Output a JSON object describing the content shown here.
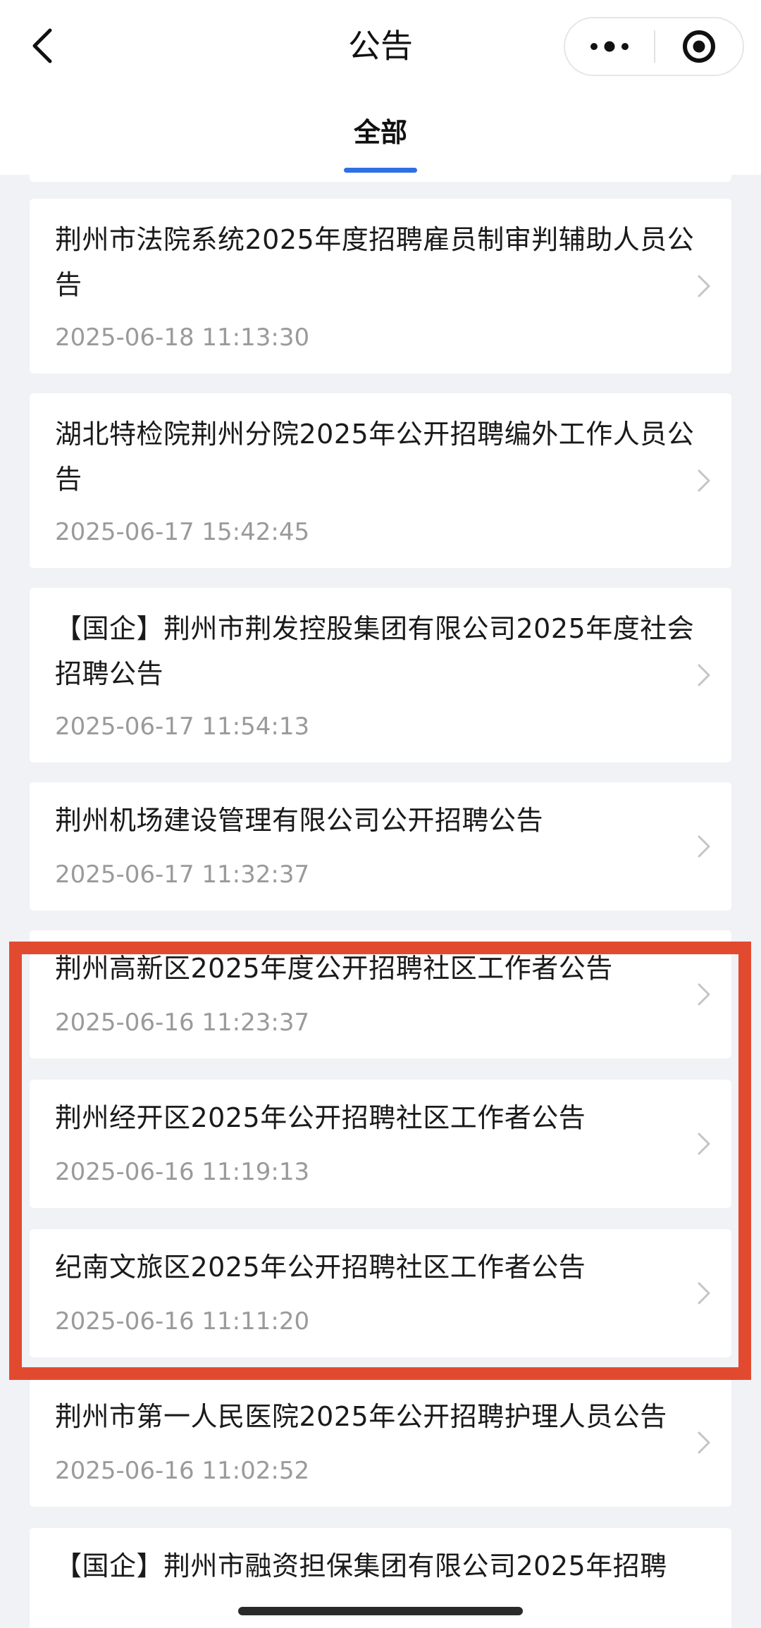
{
  "header": {
    "title": "公告",
    "tab_label": "全部",
    "accent_color": "#2f6fe4",
    "back_icon": "chevron-left-icon",
    "more_icon": "more-dots-icon",
    "close_icon": "target-circle-icon"
  },
  "announcements": [
    {
      "title": "荆州市法院系统2025年度招聘雇员制审判辅助人员公告",
      "date": "2025-06-18 11:13:30"
    },
    {
      "title": "湖北特检院荆州分院2025年公开招聘编外工作人员公告",
      "date": "2025-06-17 15:42:45"
    },
    {
      "title": "【国企】荆州市荆发控股集团有限公司2025年度社会招聘公告",
      "date": "2025-06-17 11:54:13"
    },
    {
      "title": "荆州机场建设管理有限公司公开招聘公告",
      "date": "2025-06-17 11:32:37"
    },
    {
      "title": "荆州高新区2025年度公开招聘社区工作者公告",
      "date": "2025-06-16 11:23:37"
    },
    {
      "title": "荆州经开区2025年公开招聘社区工作者公告",
      "date": "2025-06-16 11:19:13"
    },
    {
      "title": "纪南文旅区2025年公开招聘社区工作者公告",
      "date": "2025-06-16 11:11:20"
    },
    {
      "title": "荆州市第一人民医院2025年公开招聘护理人员公告",
      "date": "2025-06-16 11:02:52"
    },
    {
      "title": "【国企】荆州市融资担保集团有限公司2025年招聘"
    }
  ],
  "highlight_color": "#e24a30"
}
